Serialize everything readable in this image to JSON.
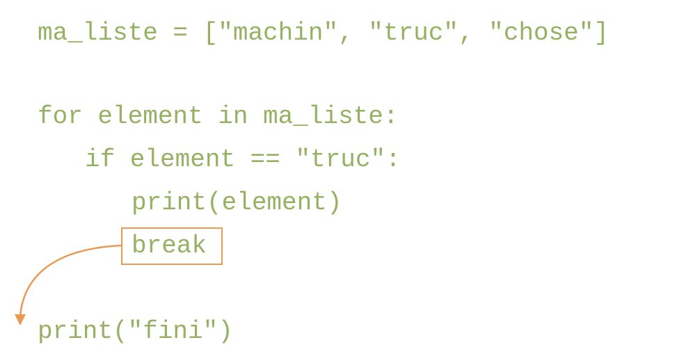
{
  "code": {
    "line1": "ma_liste = [\"machin\", \"truc\", \"chose\"]",
    "line2": "for element in ma_liste:",
    "line3": "if element == \"truc\":",
    "line4": "print(element)",
    "line5": "break",
    "line6": "print(\"fini\")"
  },
  "colors": {
    "code_text": "#97b164",
    "highlight": "#e89a52"
  }
}
